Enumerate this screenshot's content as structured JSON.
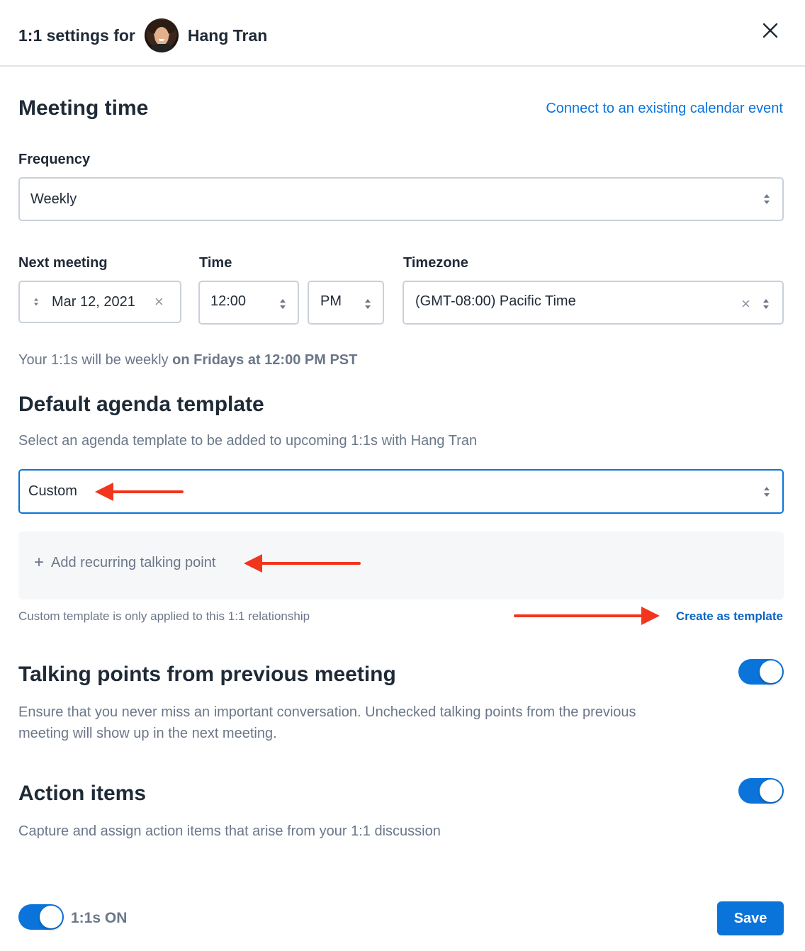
{
  "header": {
    "title_prefix": "1:1 settings for",
    "person_name": "Hang Tran",
    "avatar_icon": "user-avatar",
    "close_icon": "close-icon"
  },
  "meeting_time": {
    "heading": "Meeting time",
    "connect_link": "Connect to an existing calendar event",
    "frequency_label": "Frequency",
    "frequency_value": "Weekly",
    "next_meeting_label": "Next meeting",
    "next_meeting_value": "Mar 12, 2021",
    "time_label": "Time",
    "time_value": "12:00",
    "ampm_value": "PM",
    "timezone_label": "Timezone",
    "timezone_value": "(GMT-08:00) Pacific Time",
    "summary_prefix": "Your 1:1s will be weekly",
    "summary_bold": "on Fridays at 12:00 PM PST"
  },
  "agenda": {
    "heading": "Default agenda template",
    "description": "Select an agenda template to be added to upcoming 1:1s with Hang Tran",
    "template_value": "Custom",
    "add_talking_point": "Add recurring talking point",
    "add_icon": "plus-icon",
    "note": "Custom template is only applied to this 1:1 relationship",
    "create_template_link": "Create as template"
  },
  "talking_points": {
    "heading": "Talking points from previous meeting",
    "description_line1": "Ensure that you never miss an important conversation. Unchecked talking points from the previous",
    "description_line2": "meeting will show up in the next meeting.",
    "enabled": true
  },
  "action_items": {
    "heading": "Action items",
    "description": "Capture and assign action items that arise from your 1:1 discussion",
    "enabled": true
  },
  "footer": {
    "one_on_ones_label": "1:1s ON",
    "one_on_ones_enabled": true,
    "save_label": "Save"
  },
  "colors": {
    "accent": "#0a74db",
    "annotation_arrow": "#f1361d",
    "text_primary": "#1f2a37",
    "text_muted": "#6b7789"
  }
}
